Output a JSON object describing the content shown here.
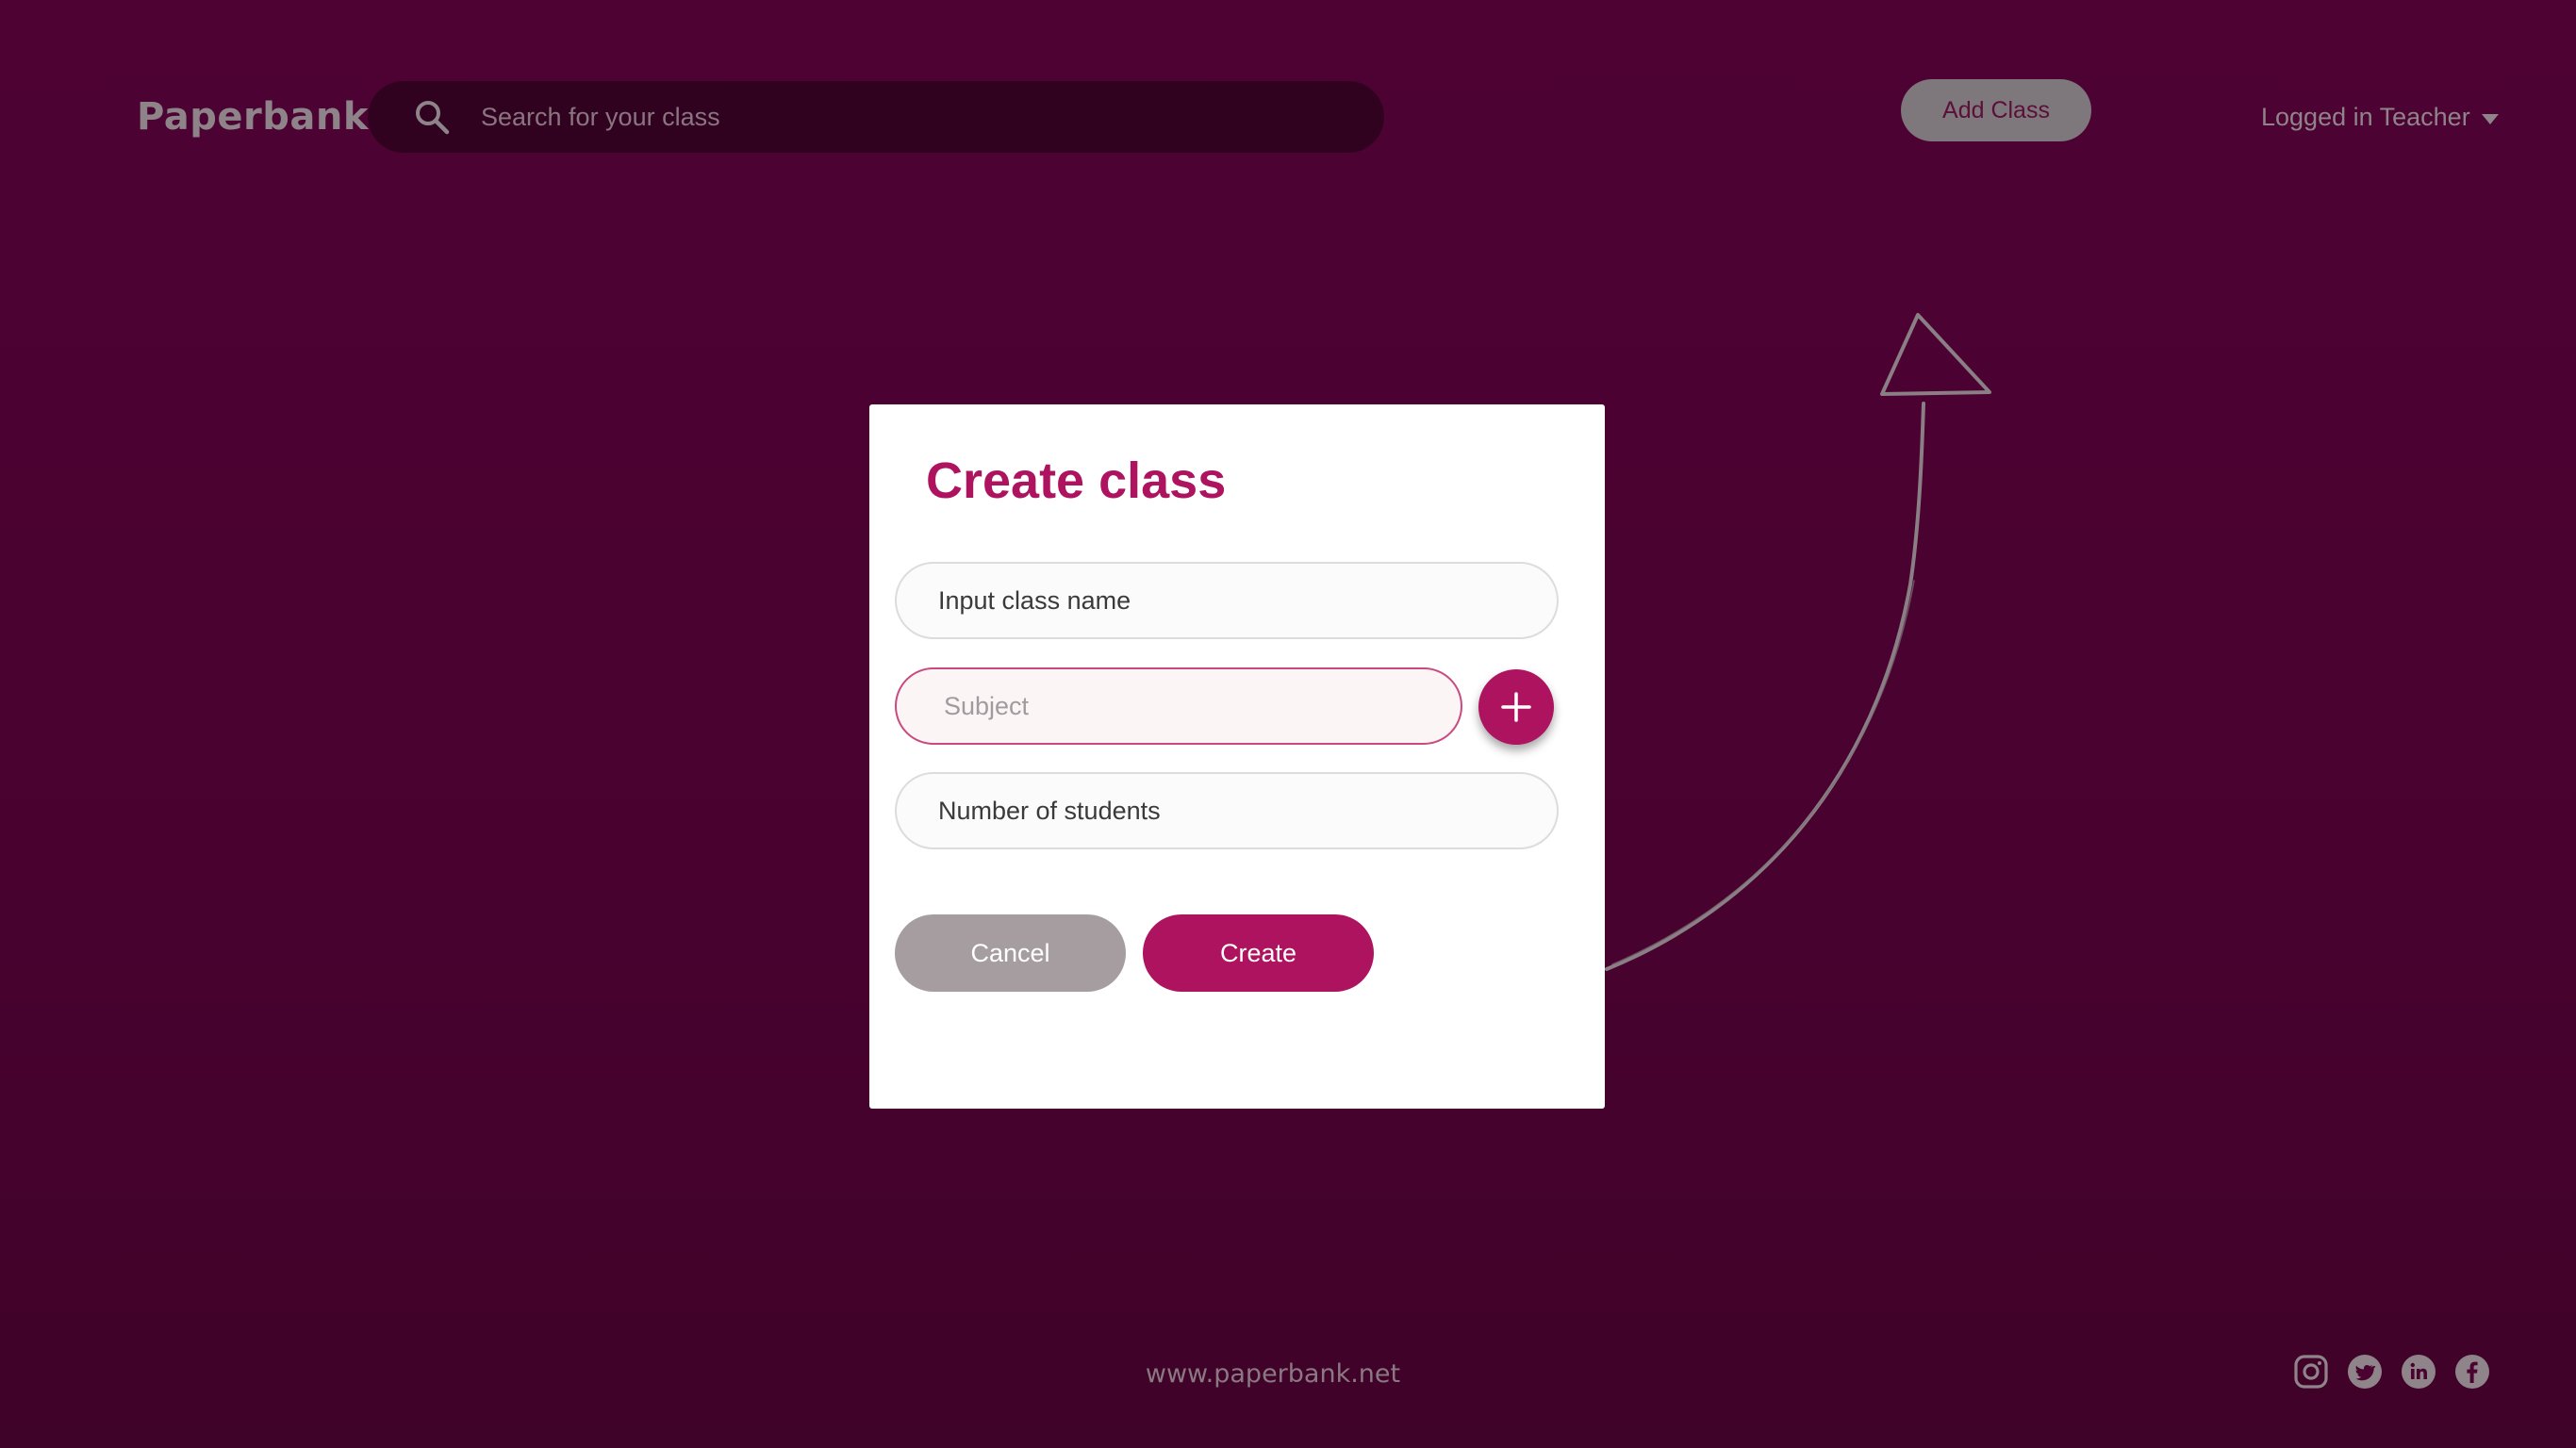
{
  "header": {
    "logo": "Paperbank",
    "search": {
      "placeholder": "Search for your class",
      "value": ""
    },
    "add_class_label": "Add Class",
    "user_menu_label": "Logged in Teacher"
  },
  "modal": {
    "title": "Create class",
    "fields": {
      "class_name_placeholder": "Input class name",
      "subject_placeholder": "Subject",
      "students_placeholder": "Number of students"
    },
    "cancel_label": "Cancel",
    "create_label": "Create"
  },
  "footer": {
    "url": "www.paperbank.net",
    "social_icons": [
      "instagram-icon",
      "twitter-icon",
      "linkedin-icon",
      "facebook-icon"
    ]
  },
  "colors": {
    "background": "#4d0233",
    "search_bg": "#310220",
    "accent": "#ad135f",
    "cancel": "#a69da1",
    "muted_text": "#8f8489"
  }
}
